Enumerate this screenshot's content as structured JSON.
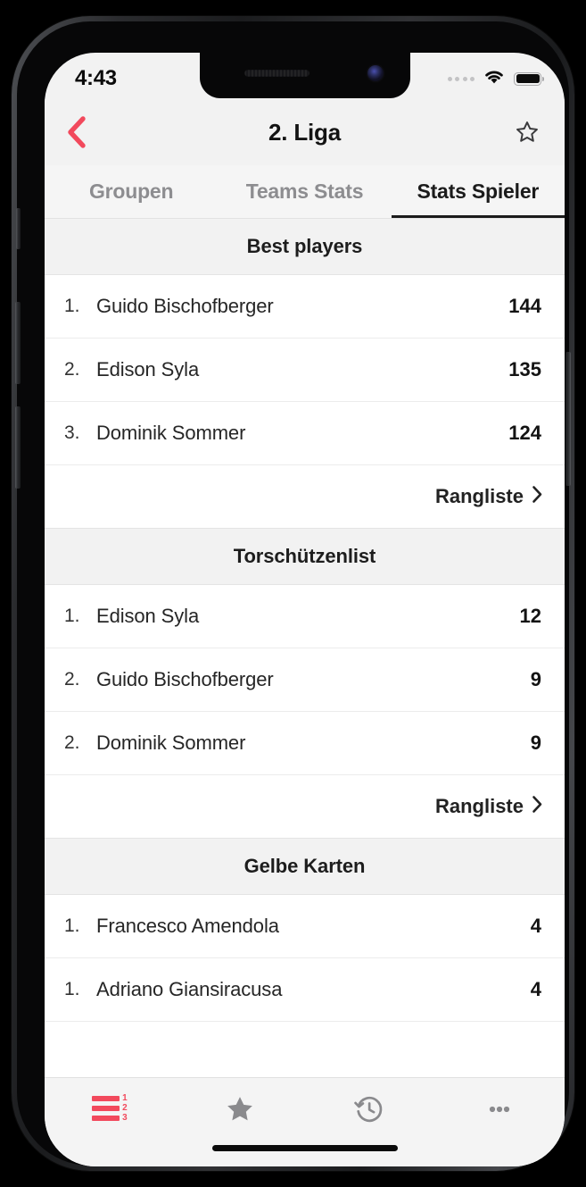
{
  "status_bar": {
    "time": "4:43",
    "signal_icon": "signal-dots-icon",
    "wifi_icon": "wifi-icon",
    "battery_icon": "battery-full-icon"
  },
  "nav": {
    "back_icon": "chevron-left-icon",
    "title": "2. Liga",
    "favorite_icon": "star-outline-icon",
    "accent_color": "#f2495c"
  },
  "tabs": [
    {
      "label": "Groupen",
      "active": false
    },
    {
      "label": "Teams Stats",
      "active": false
    },
    {
      "label": "Stats Spieler",
      "active": true
    }
  ],
  "sections": [
    {
      "title": "Best players",
      "rows": [
        {
          "rank": "1.",
          "name": "Guido Bischofberger",
          "value": "144"
        },
        {
          "rank": "2.",
          "name": "Edison Syla",
          "value": "135"
        },
        {
          "rank": "3.",
          "name": "Dominik Sommer",
          "value": "124"
        }
      ],
      "link_label": "Rangliste",
      "link_icon": "chevron-right-icon"
    },
    {
      "title": "Torschützenlist",
      "rows": [
        {
          "rank": "1.",
          "name": "Edison Syla",
          "value": "12"
        },
        {
          "rank": "2.",
          "name": "Guido Bischofberger",
          "value": "9"
        },
        {
          "rank": "2.",
          "name": "Dominik Sommer",
          "value": "9"
        }
      ],
      "link_label": "Rangliste",
      "link_icon": "chevron-right-icon"
    },
    {
      "title": "Gelbe Karten",
      "rows": [
        {
          "rank": "1.",
          "name": "Francesco Amendola",
          "value": "4"
        },
        {
          "rank": "1.",
          "name": "Adriano Giansiracusa",
          "value": "4"
        }
      ],
      "link_label": null,
      "link_icon": null
    }
  ],
  "tab_bar": [
    {
      "icon": "ranking-list-icon",
      "active": true,
      "numbers": [
        "1",
        "2",
        "3"
      ]
    },
    {
      "icon": "star-filled-icon",
      "active": false
    },
    {
      "icon": "history-clock-icon",
      "active": false
    },
    {
      "icon": "ellipsis-icon",
      "active": false
    }
  ]
}
